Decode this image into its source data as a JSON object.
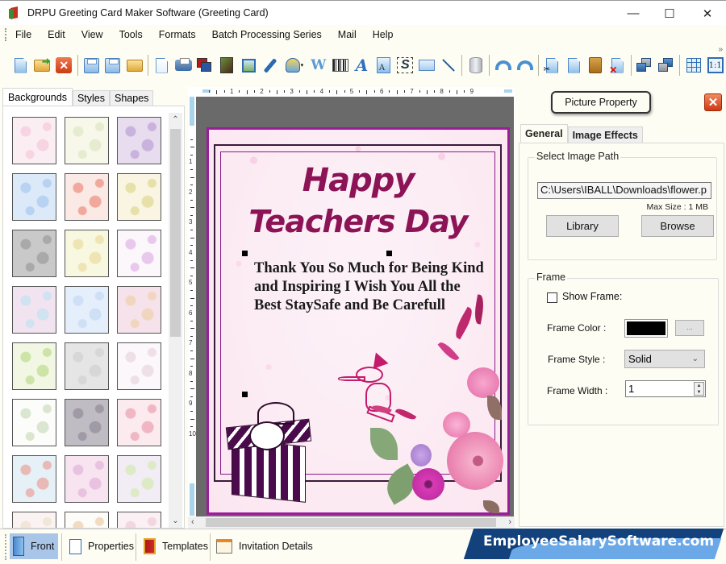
{
  "window": {
    "title": "DRPU Greeting Card Maker Software (Greeting Card)",
    "controls": {
      "minimize": "—",
      "maximize": "☐",
      "close": "✕"
    }
  },
  "menu": [
    "File",
    "Edit",
    "View",
    "Tools",
    "Formats",
    "Batch Processing Series",
    "Mail",
    "Help"
  ],
  "toolbar": {
    "icons": [
      "new-icon",
      "open-icon",
      "close-icon",
      "save-icon",
      "save-as-icon",
      "export-icon",
      "properties-icon",
      "print-icon",
      "print-preview-icon",
      "background-icon",
      "insert-image-icon",
      "signature-pen-icon",
      "shapes-icon",
      "word-art-icon",
      "barcode-icon",
      "text-icon",
      "text-style-icon",
      "mail-icon",
      "line-icon",
      "database-icon",
      "undo-icon",
      "redo-icon",
      "cut-icon",
      "copy-icon",
      "paste-icon",
      "delete-icon",
      "bring-front-icon",
      "send-back-icon",
      "grid-icon",
      "actual-size-icon"
    ],
    "overflow": "»",
    "close_glyph": "✕",
    "actual_size_label": "1:1"
  },
  "left_panel": {
    "tabs": [
      "Backgrounds",
      "Styles",
      "Shapes"
    ],
    "active_tab": "Backgrounds",
    "thumbnails": [
      {
        "name": "baby-items",
        "color1": "#fbeef3",
        "color2": "#f7d4e2"
      },
      {
        "name": "baby-toys",
        "color1": "#f7f8ea",
        "color2": "#e6ecd0"
      },
      {
        "name": "purple-floral",
        "color1": "#e8dcef",
        "color2": "#c9b3dd"
      },
      {
        "name": "sky-clouds",
        "color1": "#dbe9f9",
        "color2": "#b8d2f2"
      },
      {
        "name": "strawberries",
        "color1": "#fbe9e5",
        "color2": "#f2a99d"
      },
      {
        "name": "leaves",
        "color1": "#f9f5e2",
        "color2": "#e7e0a9"
      },
      {
        "name": "grey-hearts",
        "color1": "#c9c9c9",
        "color2": "#a9a9a9"
      },
      {
        "name": "flower-meadow",
        "color1": "#f8f7df",
        "color2": "#efe4b4"
      },
      {
        "name": "gift-boxes",
        "color1": "#fbf7fb",
        "color2": "#e8c8ec"
      },
      {
        "name": "pastel-flowers",
        "color1": "#f2e3f1",
        "color2": "#cfe3f1"
      },
      {
        "name": "blue-snowflakes",
        "color1": "#e5eefb",
        "color2": "#cfdff6"
      },
      {
        "name": "pastel-circles",
        "color1": "#f6e2ea",
        "color2": "#f1d6bf"
      },
      {
        "name": "green-trees",
        "color1": "#f1f7e3",
        "color2": "#cde4a6"
      },
      {
        "name": "white-heart",
        "color1": "#e5e5e5",
        "color2": "#d7d7d7"
      },
      {
        "name": "doodle-text",
        "color1": "#fbf7fa",
        "color2": "#efdfe7"
      },
      {
        "name": "holly",
        "color1": "#fcfdfb",
        "color2": "#dbe6d0"
      },
      {
        "name": "bokeh-lights",
        "color1": "#bfbcc3",
        "color2": "#9f9aa6"
      },
      {
        "name": "red-hearts",
        "color1": "#fbeaee",
        "color2": "#f0b6c3"
      },
      {
        "name": "santa-pattern",
        "color1": "#e6f1f7",
        "color2": "#e8b9b6"
      },
      {
        "name": "pink-bubbles",
        "color1": "#f7e4f0",
        "color2": "#e8c2e0"
      },
      {
        "name": "butterflies",
        "color1": "#f2ecf4",
        "color2": "#dcebc6"
      },
      {
        "name": "pastel-stripes",
        "color1": "#fbf2f2",
        "color2": "#f1e6d9"
      },
      {
        "name": "teddy-bear",
        "color1": "#fefcf8",
        "color2": "#f1dcc1"
      },
      {
        "name": "pink-lace",
        "color1": "#fbf1f4",
        "color2": "#f2d6e0"
      }
    ],
    "scroll_up": "⌃",
    "scroll_down": "⌄"
  },
  "ruler": {
    "h_numbers": [
      "1",
      "2",
      "3",
      "4",
      "5",
      "6",
      "7",
      "8",
      "9"
    ],
    "v_numbers": [
      "1",
      "2",
      "3",
      "4",
      "5",
      "6",
      "7",
      "8",
      "9",
      "10"
    ]
  },
  "card": {
    "title_line1": "Happy",
    "title_line2": "Teachers Day",
    "message": "Thank You So Much for Being Kind and Inspiring I Wish You All the Best StaySafe and Be Carefull",
    "title_color": "#8c1456",
    "border_color": "#9a1e9a"
  },
  "canvas_scroll": {
    "left": "‹",
    "right": "›"
  },
  "right_panel": {
    "title": "Picture Property",
    "close_glyph": "✕",
    "tabs": [
      "General",
      "Image Effects"
    ],
    "active_tab": "General",
    "image_path_group": {
      "label": "Select Image Path",
      "path_value": "C:\\Users\\IBALL\\Downloads\\flower.p",
      "max_size": "Max Size : 1 MB",
      "library_button": "Library",
      "browse_button": "Browse"
    },
    "frame_group": {
      "label": "Frame",
      "show_frame_label": "Show Frame:",
      "show_frame_checked": false,
      "frame_color_label": "Frame Color :",
      "frame_color_value": "#000000",
      "color_picker_button": "...",
      "frame_style_label": "Frame Style :",
      "frame_style_value": "Solid",
      "frame_width_label": "Frame Width :",
      "frame_width_value": "1"
    }
  },
  "bottom_bar": {
    "items": [
      {
        "label": "Front",
        "active": true
      },
      {
        "label": "Properties",
        "active": false
      },
      {
        "label": "Templates",
        "active": false
      },
      {
        "label": "Invitation Details",
        "active": false
      }
    ]
  },
  "watermark": "EmployeeSalarySoftware.com"
}
